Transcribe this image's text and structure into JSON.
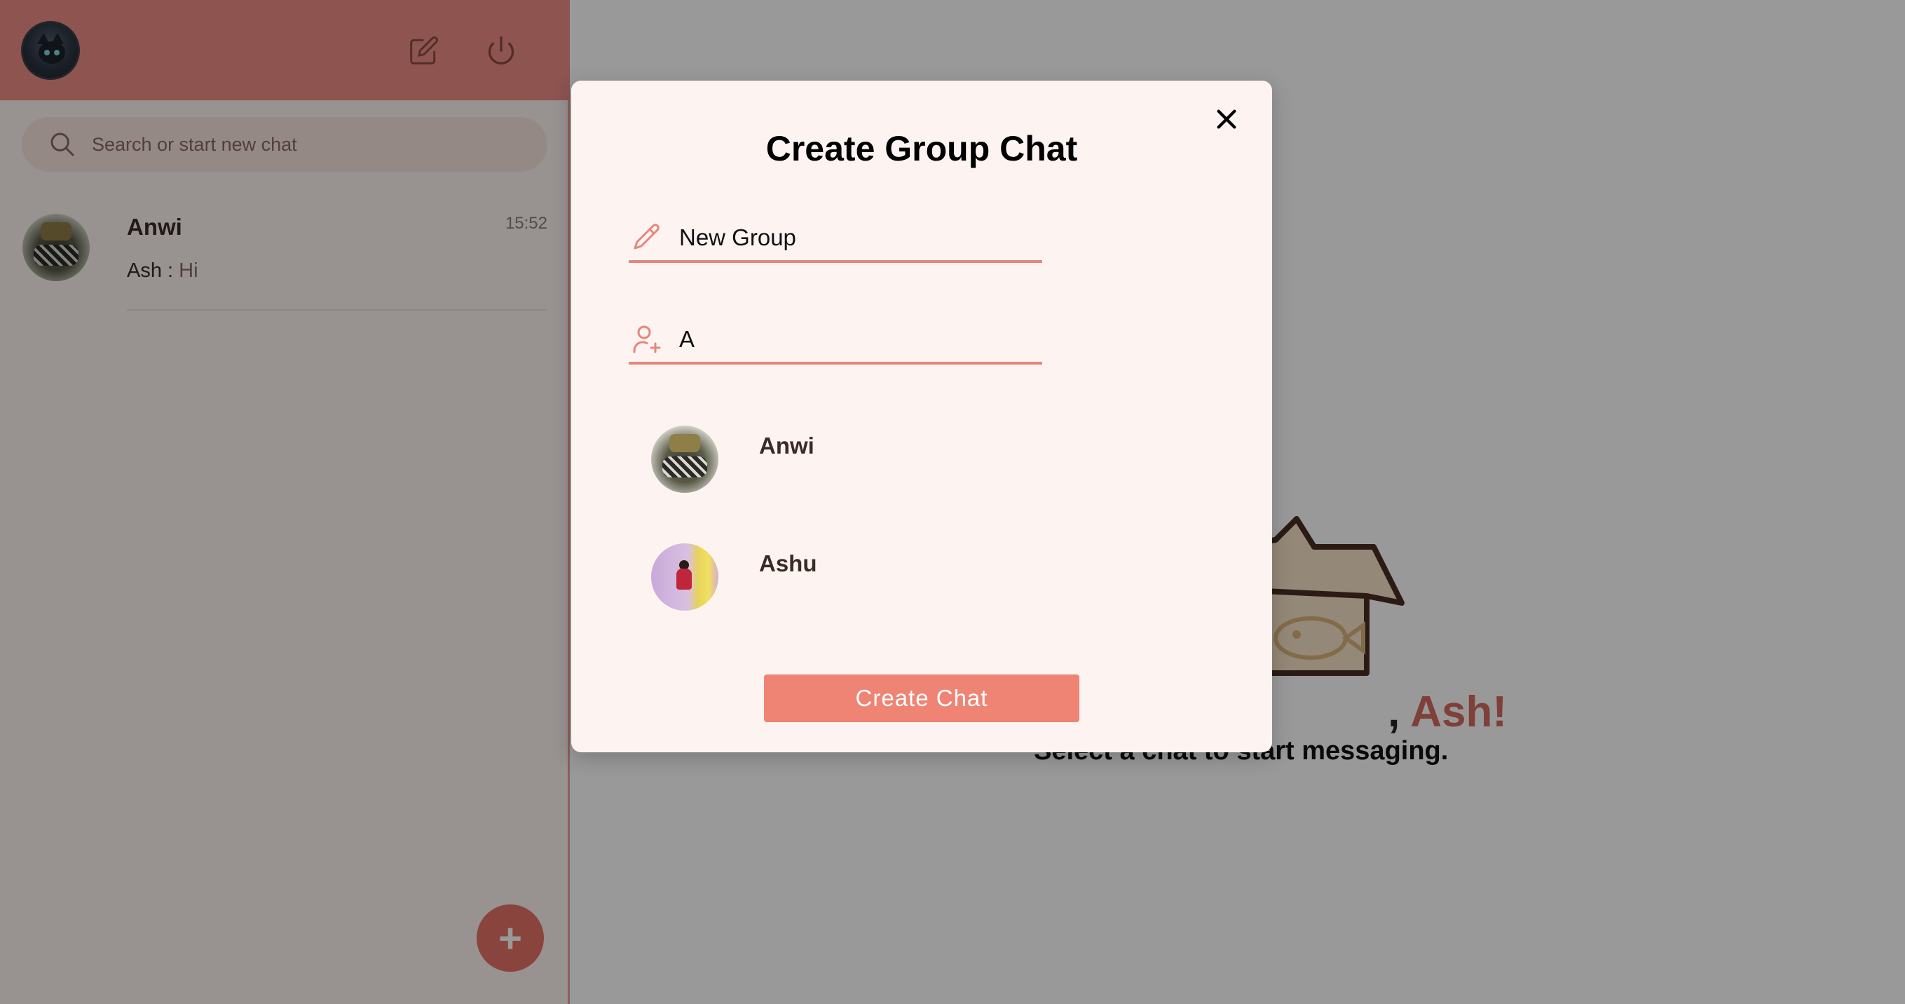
{
  "sidebar": {
    "header": {
      "avatar_icon": "profile-avatar",
      "new_chat_icon": "edit-icon",
      "logout_icon": "power-icon"
    },
    "search": {
      "placeholder": "Search or start new chat",
      "icon": "search-icon"
    },
    "chats": [
      {
        "name": "Anwi",
        "time": "15:52",
        "sender": "Ash : ",
        "message": "Hi"
      }
    ],
    "fab_label": "+"
  },
  "main": {
    "welcome_prefix": ", ",
    "welcome_user": "Ash!",
    "subtitle": "Select a chat to start messaging."
  },
  "modal": {
    "title": "Create Group Chat",
    "close_icon": "close-icon",
    "group_name": {
      "value": "New Group",
      "icon": "pencil-icon"
    },
    "member_search": {
      "value": "A",
      "icon": "add-user-icon"
    },
    "results": [
      {
        "name": "Anwi"
      },
      {
        "name": "Ashu"
      }
    ],
    "create_button": "Create Chat"
  },
  "colors": {
    "accent": "#ec8d85",
    "button": "#ef8474",
    "fab": "#e57366",
    "modal_bg": "#fdf4f2"
  }
}
